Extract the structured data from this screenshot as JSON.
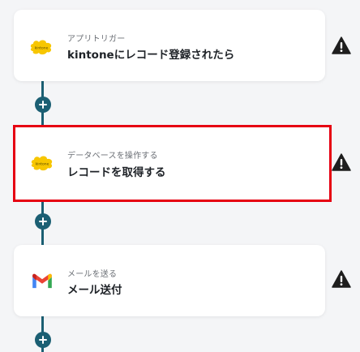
{
  "flow": {
    "steps": [
      {
        "category": "アプリトリガー",
        "title": "kintoneにレコード登録されたら",
        "icon": "kintone-icon",
        "selected": false,
        "status": "warning"
      },
      {
        "category": "データベースを操作する",
        "title": "レコードを取得する",
        "icon": "kintone-icon",
        "selected": true,
        "status": "warning"
      },
      {
        "category": "メールを送る",
        "title": "メール送付",
        "icon": "gmail-icon",
        "selected": false,
        "status": "warning"
      }
    ],
    "kintone_logo_text": "kintone"
  },
  "colors": {
    "connector": "#1b5f73",
    "selected_border": "#e60012",
    "kintone_yellow": "#f7c600",
    "warning": "#1e1e1e"
  }
}
